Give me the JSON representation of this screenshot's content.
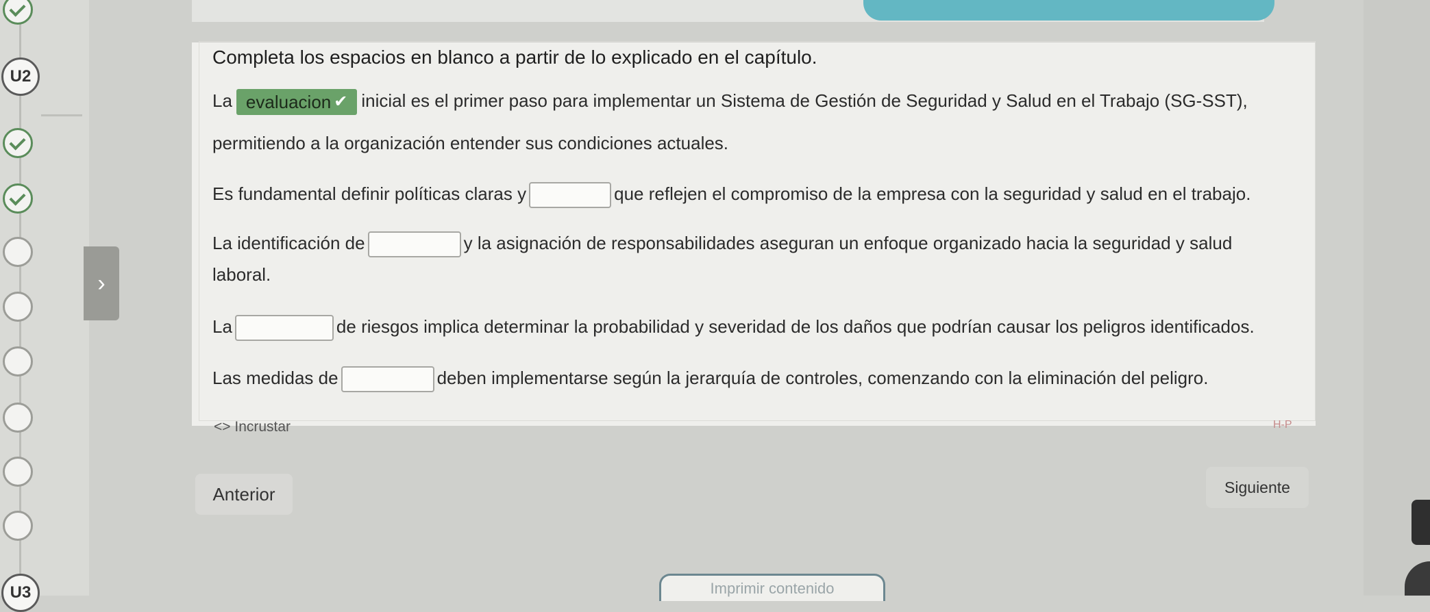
{
  "rail": {
    "unit_top": "U2",
    "unit_bottom": "U3",
    "nodes": [
      "done",
      "done",
      "done",
      "empty",
      "empty",
      "empty",
      "empty",
      "empty",
      "empty"
    ]
  },
  "exercise": {
    "instruction": "Completa los espacios en blanco a partir de lo explicado en el capítulo.",
    "s1_before": "La",
    "s1_answer": "evaluacion",
    "s1_check": "✔",
    "s1_after": "inicial es el primer paso para implementar un Sistema de Gestión de Seguridad y Salud en el Trabajo (SG-SST),",
    "s1_line2": "permitiendo a la organización entender sus condiciones actuales.",
    "s2_before": "Es fundamental definir políticas claras y",
    "s2_after": "que reflejen el compromiso de la empresa con la seguridad y salud en el trabajo.",
    "s3_before": "La identificación de",
    "s3_after": "y la asignación de responsabilidades aseguran un enfoque organizado hacia la seguridad y salud",
    "s3_line2": "laboral.",
    "s4_before": "La",
    "s4_after": "de riesgos implica determinar la probabilidad y severidad de los daños que podrían causar los peligros identificados.",
    "s5_before": "Las medidas de",
    "s5_after": "deben implementarse según la jerarquía de controles, comenzando con la eliminación del peligro."
  },
  "embed_label": "<> Incrustar",
  "hp_label": "H-P",
  "nav": {
    "prev": "Anterior",
    "next": "Siguiente"
  },
  "print_label": "Imprimir contenido",
  "colors": {
    "correct": "#6aa269",
    "accent": "#63b7c3"
  }
}
